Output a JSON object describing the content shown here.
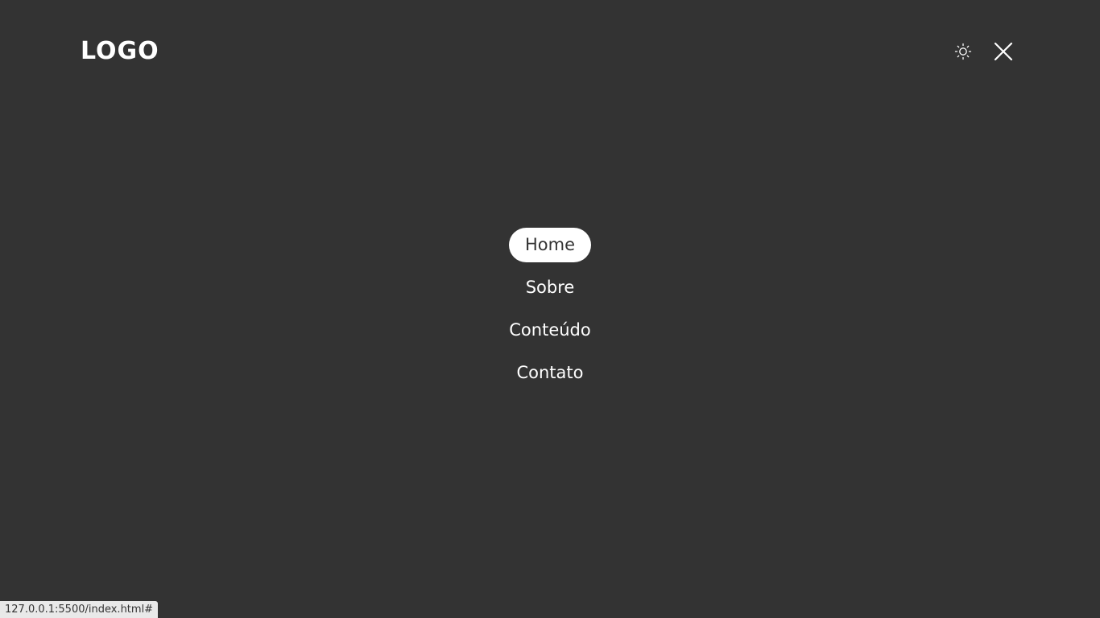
{
  "header": {
    "logo": "LOGO",
    "theme_icon": "sun-icon",
    "close_icon": "close-icon"
  },
  "menu": {
    "items": [
      {
        "label": "Home",
        "active": true
      },
      {
        "label": "Sobre",
        "active": false
      },
      {
        "label": "Conteúdo",
        "active": false
      },
      {
        "label": "Contato",
        "active": false
      }
    ]
  },
  "status_bar": {
    "url": "127.0.0.1:5500/index.html#"
  },
  "colors": {
    "background": "#333333",
    "foreground": "#ffffff",
    "active_bg": "#ffffff",
    "active_fg": "#333333"
  }
}
